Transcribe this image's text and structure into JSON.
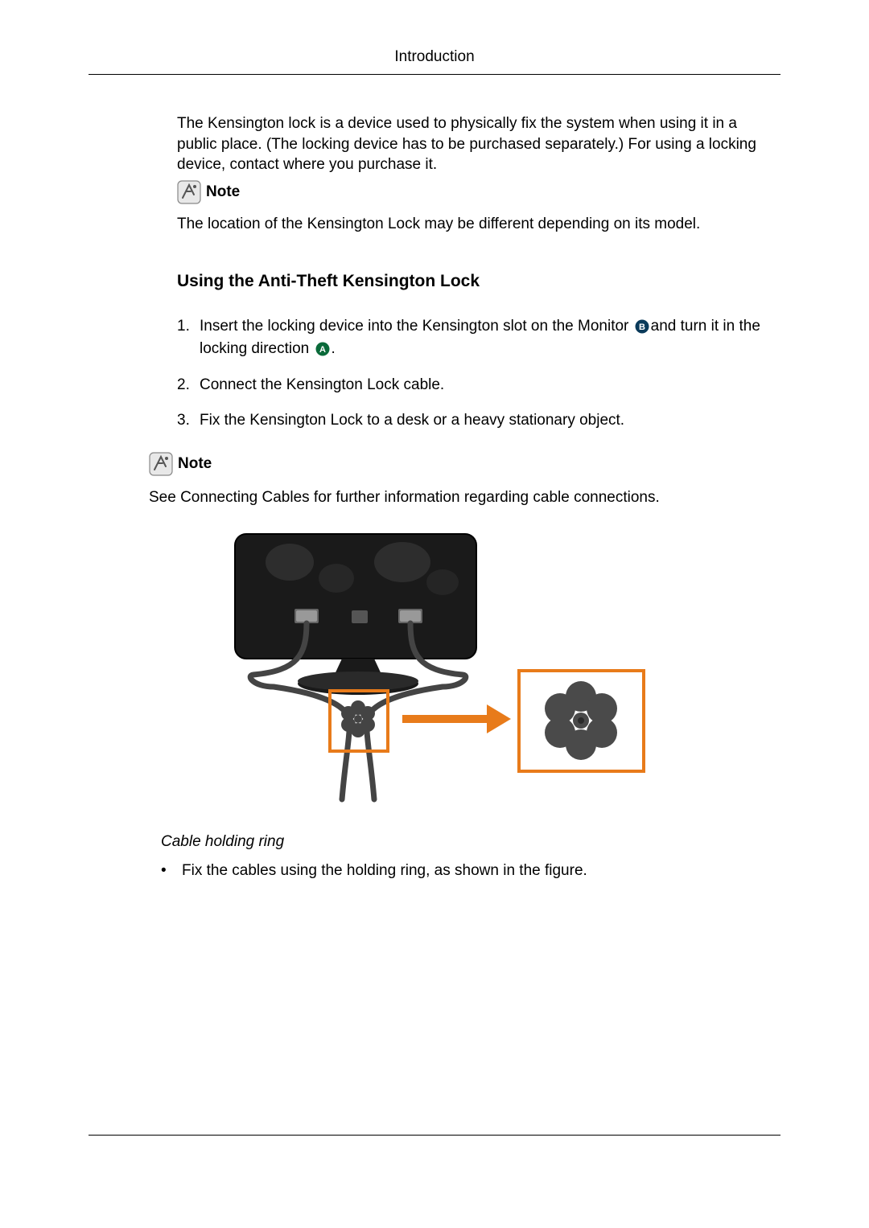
{
  "header": {
    "title": "Introduction"
  },
  "intro": {
    "paragraph": "The Kensington lock is a device used to physically fix the system when using it in a public place. (The locking device has to be purchased separately.) For using a locking device, contact where you purchase it."
  },
  "note1": {
    "label": "Note",
    "text": "The location of the Kensington Lock may be different depending on its model."
  },
  "section": {
    "heading": "Using the Anti-Theft Kensington Lock",
    "steps": [
      {
        "num": "1.",
        "text_before": "Insert the locking device into the Kensington slot on the Monitor ",
        "badge_b": "B",
        "text_mid": "and turn it in the locking direction ",
        "badge_a": "A",
        "text_after": "."
      },
      {
        "num": "2.",
        "text": "Connect the Kensington Lock cable."
      },
      {
        "num": "3.",
        "text": "Fix the Kensington Lock to a desk or a heavy stationary object."
      }
    ]
  },
  "note2": {
    "label": "Note",
    "text": "See Connecting Cables for further information regarding cable connections."
  },
  "figure": {
    "caption": "Cable holding ring",
    "bullet": "Fix the cables using the holding ring, as shown in the figure."
  }
}
